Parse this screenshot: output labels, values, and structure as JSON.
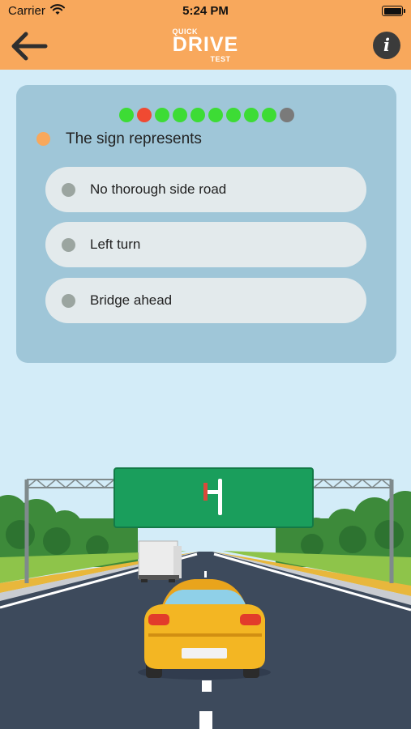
{
  "status_bar": {
    "carrier": "Carrier",
    "time": "5:24 PM"
  },
  "nav": {
    "logo": {
      "line1": "QUICK",
      "line2": "DRIVE",
      "line3": "TEST"
    },
    "info_label": "i"
  },
  "progress": {
    "dots": [
      {
        "state": "correct",
        "color": "#3ddc35"
      },
      {
        "state": "wrong",
        "color": "#f04a32"
      },
      {
        "state": "correct",
        "color": "#3ddc35"
      },
      {
        "state": "correct",
        "color": "#3ddc35"
      },
      {
        "state": "correct",
        "color": "#3ddc35"
      },
      {
        "state": "correct",
        "color": "#3ddc35"
      },
      {
        "state": "correct",
        "color": "#3ddc35"
      },
      {
        "state": "correct",
        "color": "#3ddc35"
      },
      {
        "state": "correct",
        "color": "#3ddc35"
      },
      {
        "state": "current",
        "color": "#7a7a7a"
      }
    ]
  },
  "question": {
    "text": "The sign represents"
  },
  "options": [
    {
      "label": "No thorough side road"
    },
    {
      "label": "Left turn"
    },
    {
      "label": "Bridge ahead"
    }
  ],
  "colors": {
    "header": "#f8a85c",
    "background": "#d3ecf8",
    "card": "#9fc6d8",
    "option": "#e3eaec",
    "sign": "#1a9e5c",
    "car": "#f3b623",
    "road": "#3d4a5c"
  }
}
